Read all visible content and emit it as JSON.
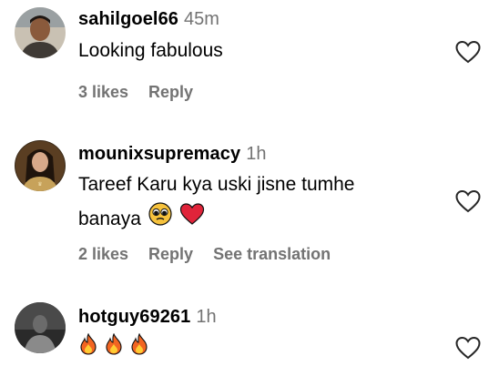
{
  "comments": [
    {
      "username": "sahilgoel66",
      "time": "45m",
      "text": "Looking fabulous",
      "likes": "3 likes",
      "reply": "Reply"
    },
    {
      "username": "mounixsupremacy",
      "time": "1h",
      "text_line1": "Tareef Karu kya uski jisne tumhe",
      "text_line2": "banaya",
      "emojis": [
        "pleading-face",
        "red-heart"
      ],
      "likes": "2 likes",
      "reply": "Reply",
      "translate": "See translation"
    },
    {
      "username": "hotguy69261",
      "time": "1h",
      "emojis": [
        "fire",
        "fire",
        "fire"
      ]
    }
  ],
  "colors": {
    "muted": "#737373",
    "text": "#000000",
    "heart_emoji": "#e0243a"
  }
}
